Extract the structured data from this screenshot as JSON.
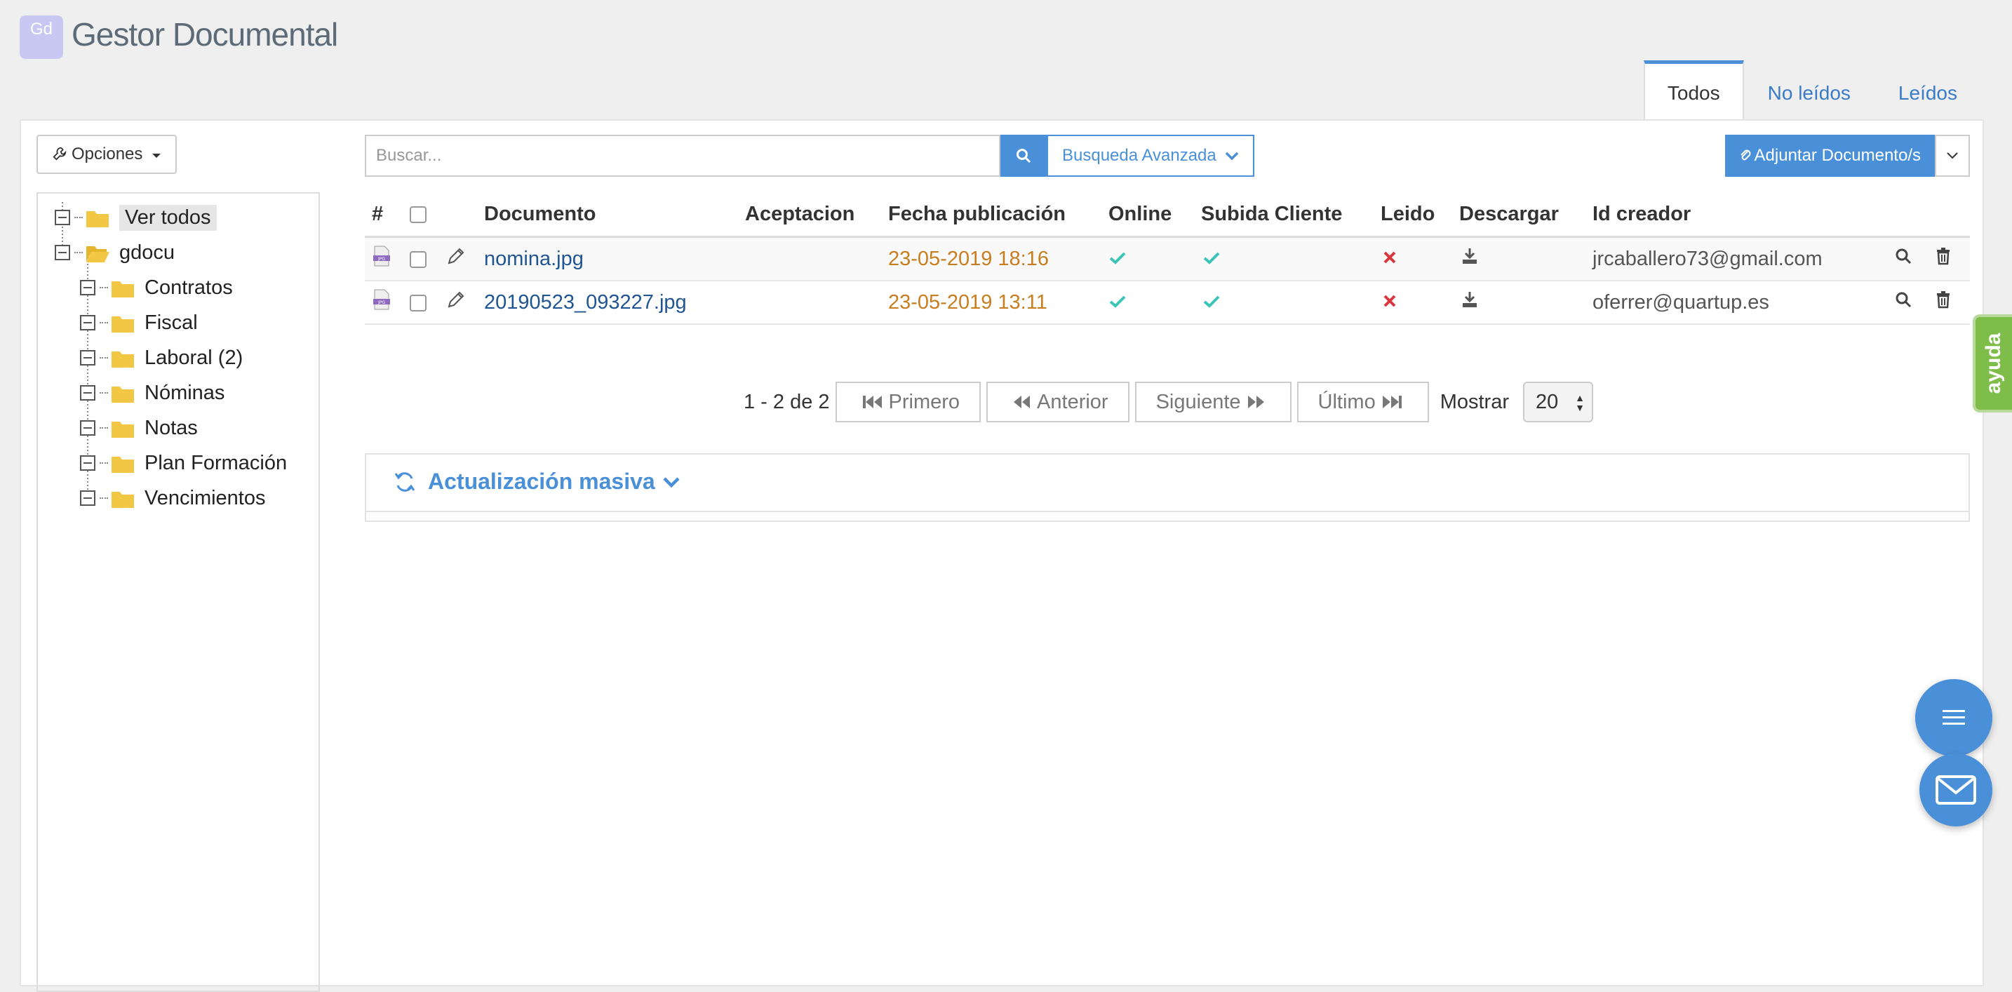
{
  "app": {
    "logo_text": "Gd",
    "title": "Gestor Documental"
  },
  "tabs": [
    {
      "label": "Todos",
      "active": true
    },
    {
      "label": "No leídos",
      "active": false
    },
    {
      "label": "Leídos",
      "active": false
    }
  ],
  "toolbar": {
    "options_label": "Opciones",
    "search_placeholder": "Buscar...",
    "advanced_label": "Busqueda Avanzada",
    "attach_label": "Adjuntar Documento/s"
  },
  "tree": {
    "items": [
      {
        "label": "Ver todos"
      },
      {
        "label": "gdocu"
      },
      {
        "label": "Contratos"
      },
      {
        "label": "Fiscal"
      },
      {
        "label": "Laboral (2)"
      },
      {
        "label": "Nóminas"
      },
      {
        "label": "Notas"
      },
      {
        "label": "Plan Formación"
      },
      {
        "label": "Vencimientos"
      }
    ]
  },
  "table": {
    "headers": {
      "num": "#",
      "documento": "Documento",
      "aceptacion": "Aceptacion",
      "fecha": "Fecha publicación",
      "online": "Online",
      "subida": "Subida Cliente",
      "leido": "Leido",
      "descargar": "Descargar",
      "creador": "Id creador"
    },
    "rows": [
      {
        "documento": "nomina.jpg",
        "aceptacion": "",
        "fecha": "23-05-2019 18:16",
        "online": true,
        "subida_cliente": true,
        "leido": false,
        "creador": "jrcaballero73@gmail.com"
      },
      {
        "documento": "20190523_093227.jpg",
        "aceptacion": "",
        "fecha": "23-05-2019 13:11",
        "online": true,
        "subida_cliente": true,
        "leido": false,
        "creador": "oferrer@quartup.es"
      }
    ]
  },
  "pagination": {
    "summary": "1 - 2 de 2",
    "first": "Primero",
    "prev": "Anterior",
    "next": "Siguiente",
    "last": "Último",
    "show_label": "Mostrar",
    "page_size": "20"
  },
  "bulk": {
    "title": "Actualización masiva"
  },
  "help_tab": "ayuda",
  "colors": {
    "accent": "#4a90d9",
    "date": "#c87e1f",
    "check": "#3cc4b8",
    "cross": "#d9363e",
    "folder": "#f2c744",
    "help": "#7fbd4a"
  }
}
